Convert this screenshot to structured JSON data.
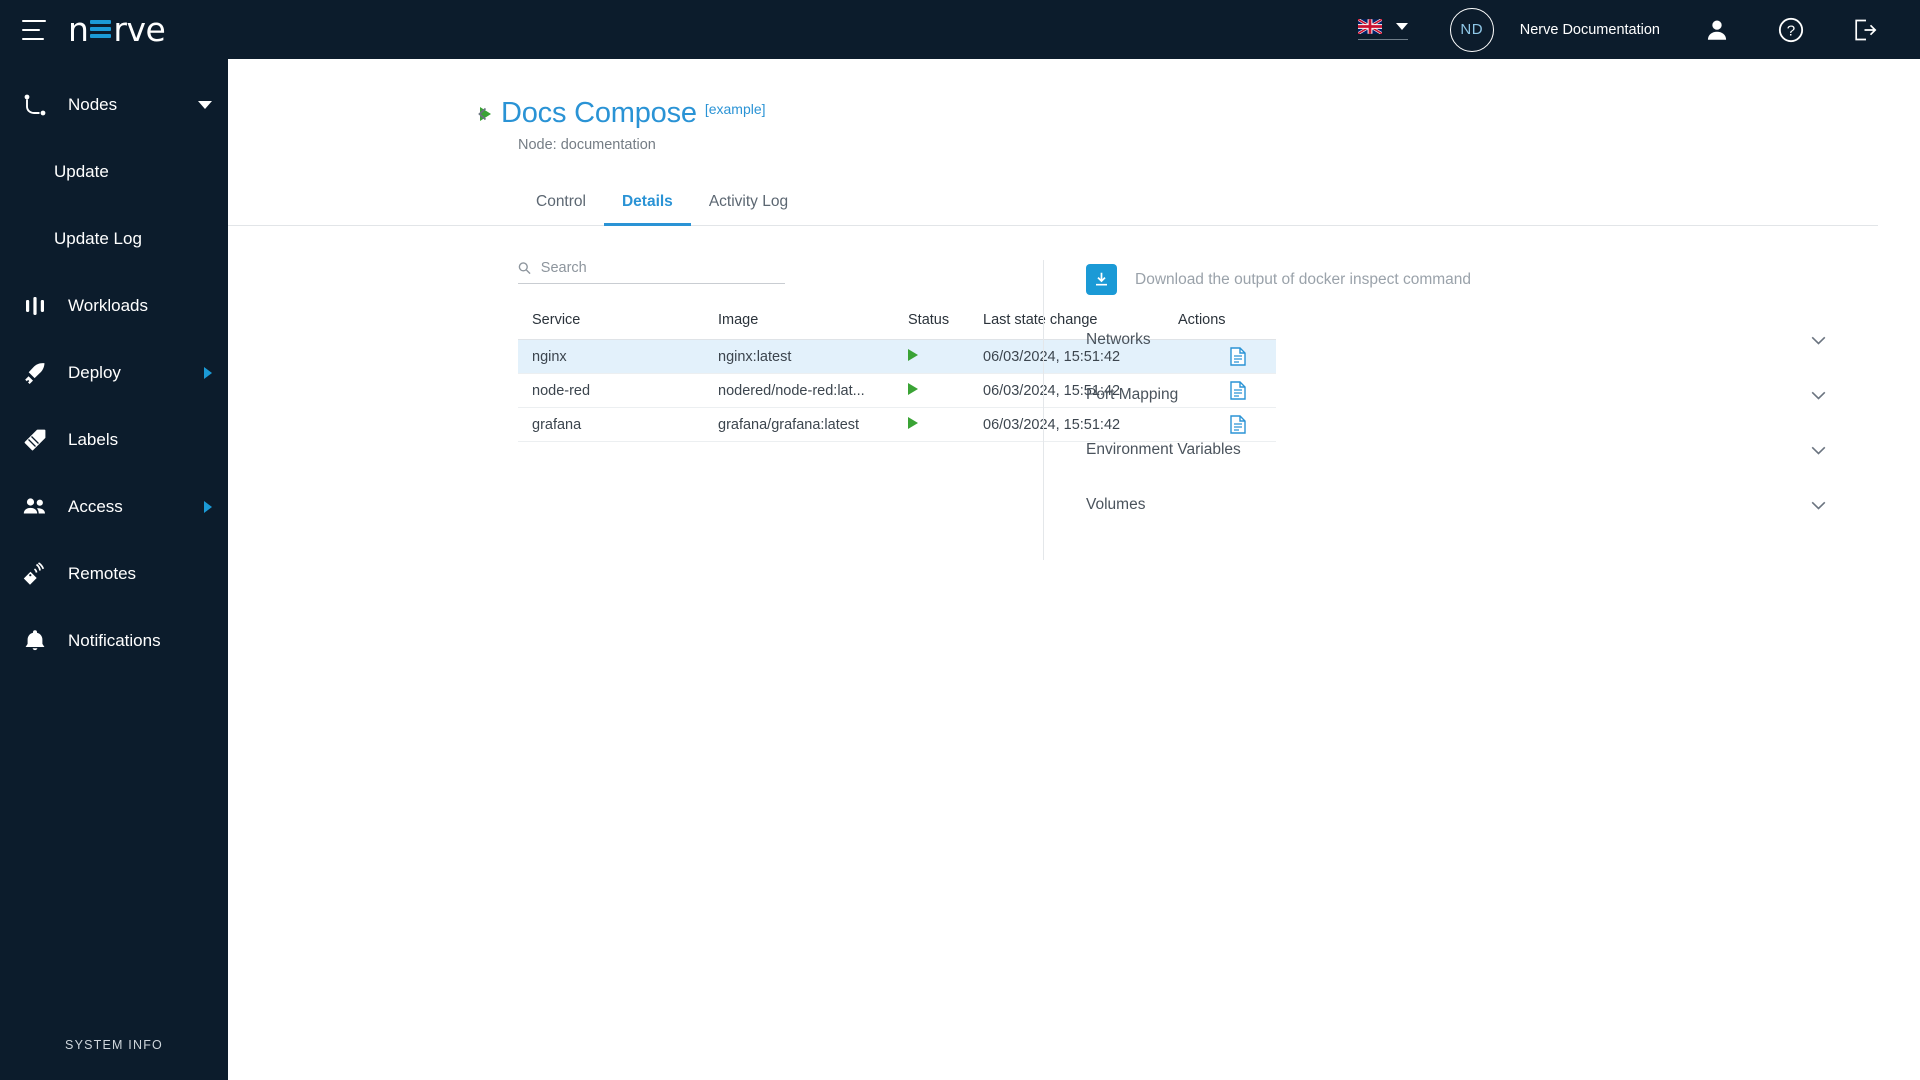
{
  "topbar": {
    "logo_prefix": "n",
    "logo_suffix": "rve",
    "menu_icon": "hamburger-icon",
    "language": "English (UK)",
    "avatar_initials": "ND",
    "org_name": "Nerve Documentation",
    "user_icon": "user-icon",
    "help_icon": "help-icon",
    "logout_icon": "logout-icon"
  },
  "sidebar": {
    "items": [
      {
        "label": "Nodes",
        "icon": "nodes-icon",
        "expanded": true,
        "sub": false
      },
      {
        "label": "Update",
        "icon": "",
        "expanded": false,
        "sub": true
      },
      {
        "label": "Update Log",
        "icon": "",
        "expanded": false,
        "sub": true
      },
      {
        "label": "Workloads",
        "icon": "workloads-icon",
        "expanded": false,
        "sub": false
      },
      {
        "label": "Deploy",
        "icon": "deploy-rocket-icon",
        "expanded": false,
        "sub": false
      },
      {
        "label": "Labels",
        "icon": "labels-tag-icon",
        "expanded": false,
        "sub": false
      },
      {
        "label": "Access",
        "icon": "access-users-icon",
        "expanded": false,
        "sub": false
      },
      {
        "label": "Remotes",
        "icon": "remotes-icon",
        "expanded": false,
        "sub": false
      },
      {
        "label": "Notifications",
        "icon": "bell-icon",
        "expanded": false,
        "sub": false
      }
    ],
    "system_info": "SYSTEM INFO"
  },
  "page": {
    "title": "Docs Compose",
    "title_tag": "[example]",
    "subtitle": "Node: documentation",
    "back_icon": "chevron-left-icon",
    "status_icon": "play-icon"
  },
  "tabs": [
    {
      "label": "Control",
      "active": false
    },
    {
      "label": "Details",
      "active": true
    },
    {
      "label": "Activity Log",
      "active": false
    }
  ],
  "search": {
    "placeholder": "Search",
    "value": "",
    "icon": "search-icon"
  },
  "table": {
    "columns": [
      "Service",
      "Image",
      "Status",
      "Last state change",
      "Actions"
    ],
    "rows": [
      {
        "service": "nginx",
        "image": "nginx:latest",
        "status": "running",
        "last_state_change": "06/03/2024, 15:51:42",
        "action_icon": "file-document-icon",
        "highlighted": true
      },
      {
        "service": "node-red",
        "image": "nodered/node-red:lat...",
        "status": "running",
        "last_state_change": "06/03/2024, 15:51:42",
        "action_icon": "file-document-icon",
        "highlighted": false
      },
      {
        "service": "grafana",
        "image": "grafana/grafana:latest",
        "status": "running",
        "last_state_change": "06/03/2024, 15:51:42",
        "action_icon": "file-document-icon",
        "highlighted": false
      }
    ]
  },
  "details_panel": {
    "download_label": "Download the output of docker inspect command",
    "download_icon": "download-icon",
    "sections": [
      {
        "label": "Networks",
        "expanded": false,
        "icon": "chevron-down-icon"
      },
      {
        "label": "Port Mapping",
        "expanded": false,
        "icon": "chevron-down-icon"
      },
      {
        "label": "Environment Variables",
        "expanded": false,
        "icon": "chevron-down-icon"
      },
      {
        "label": "Volumes",
        "expanded": false,
        "icon": "chevron-down-icon"
      }
    ]
  },
  "colors": {
    "brand_dark": "#0c1c2c",
    "accent_blue": "#1b9ad6",
    "link_blue": "#2a93d5",
    "status_green": "#3aa335",
    "row_highlight": "#e3f1fb"
  }
}
